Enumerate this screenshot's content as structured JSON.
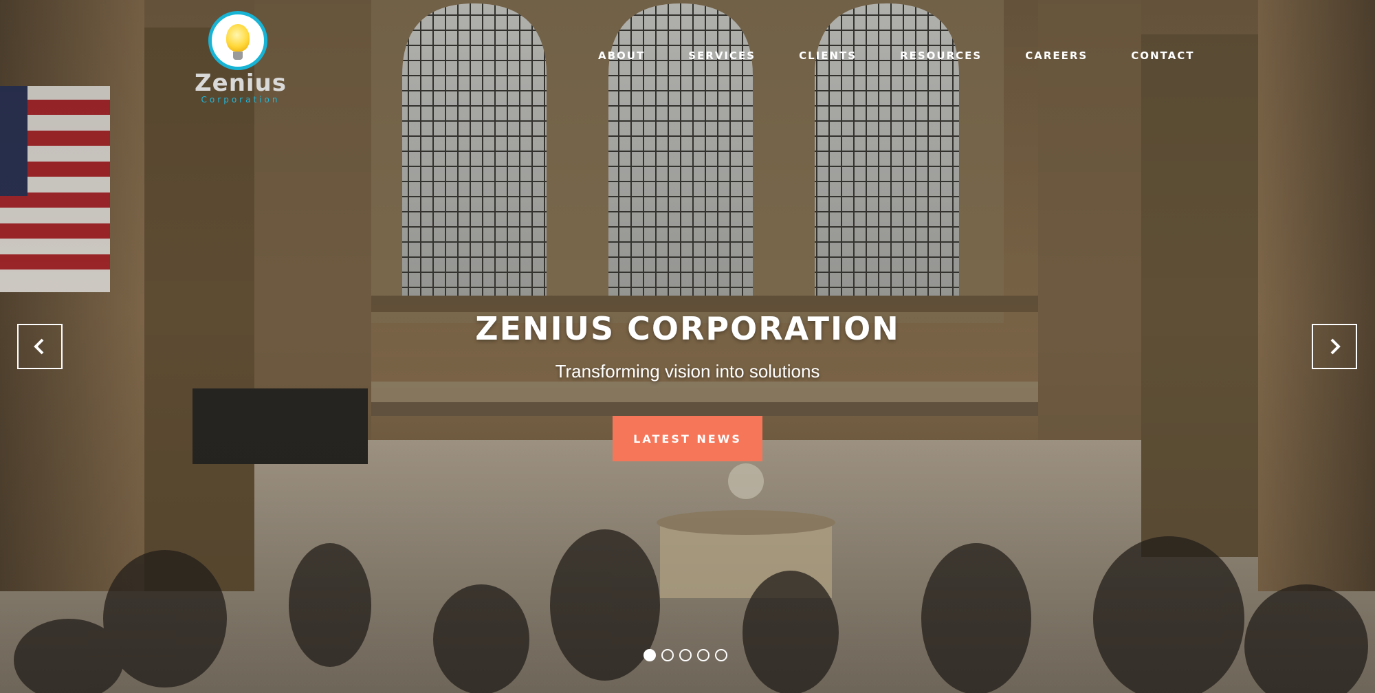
{
  "logo": {
    "name": "Zenius",
    "sub": "Corporation"
  },
  "nav": [
    {
      "label": "ABOUT"
    },
    {
      "label": "SERVICES"
    },
    {
      "label": "CLIENTS"
    },
    {
      "label": "RESOURCES"
    },
    {
      "label": "CAREERS"
    },
    {
      "label": "CONTACT"
    }
  ],
  "slide": {
    "title": "ZENIUS CORPORATION",
    "subtitle": "Transforming vision into solutions",
    "button": "LATEST NEWS"
  },
  "slider": {
    "total": 5,
    "active_index": 0
  },
  "colors": {
    "accent": "#f6765a",
    "logo_ring": "#18b4d6"
  }
}
